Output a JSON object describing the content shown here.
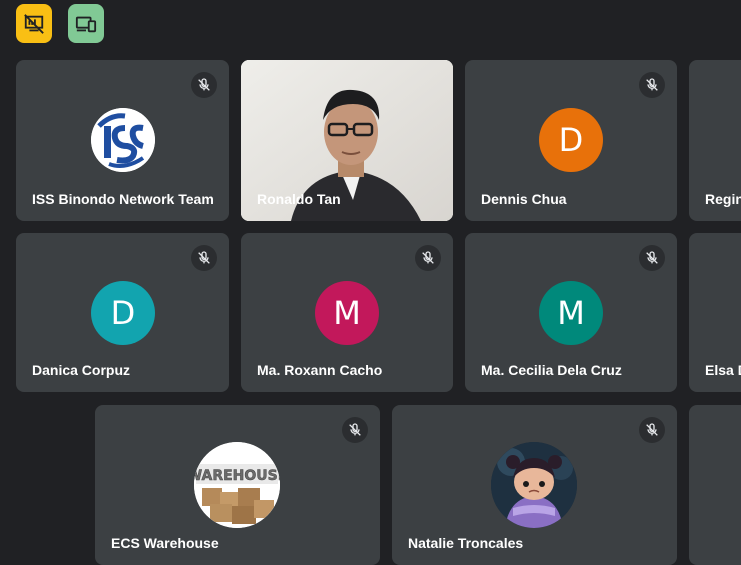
{
  "toolbar": {
    "present_icon": "presentation-off-icon",
    "devices_icon": "devices-icon",
    "present_color": "#f9bf14",
    "devices_color": "#81c995"
  },
  "participants": [
    {
      "name": "ISS Binondo Network Team",
      "avatar": "iss-logo",
      "muted": true
    },
    {
      "name": "Ronaldo Tan",
      "avatar": "video",
      "muted": false
    },
    {
      "name": "Dennis Chua",
      "avatar": "D",
      "color": "#e8710a",
      "muted": true
    },
    {
      "name": "Regin",
      "avatar": "",
      "muted": false
    },
    {
      "name": "Danica Corpuz",
      "avatar": "D",
      "color": "#12a4af",
      "muted": true
    },
    {
      "name": "Ma. Roxann Cacho",
      "avatar": "M",
      "color": "#c2185b",
      "muted": true
    },
    {
      "name": "Ma. Cecilia Dela Cruz",
      "avatar": "M",
      "color": "#00897b",
      "muted": true
    },
    {
      "name": "Elsa D",
      "avatar": "",
      "muted": false
    },
    {
      "name": "ECS Warehouse",
      "avatar": "warehouse-image",
      "muted": true
    },
    {
      "name": "Natalie Troncales",
      "avatar": "character-image",
      "muted": true
    }
  ]
}
